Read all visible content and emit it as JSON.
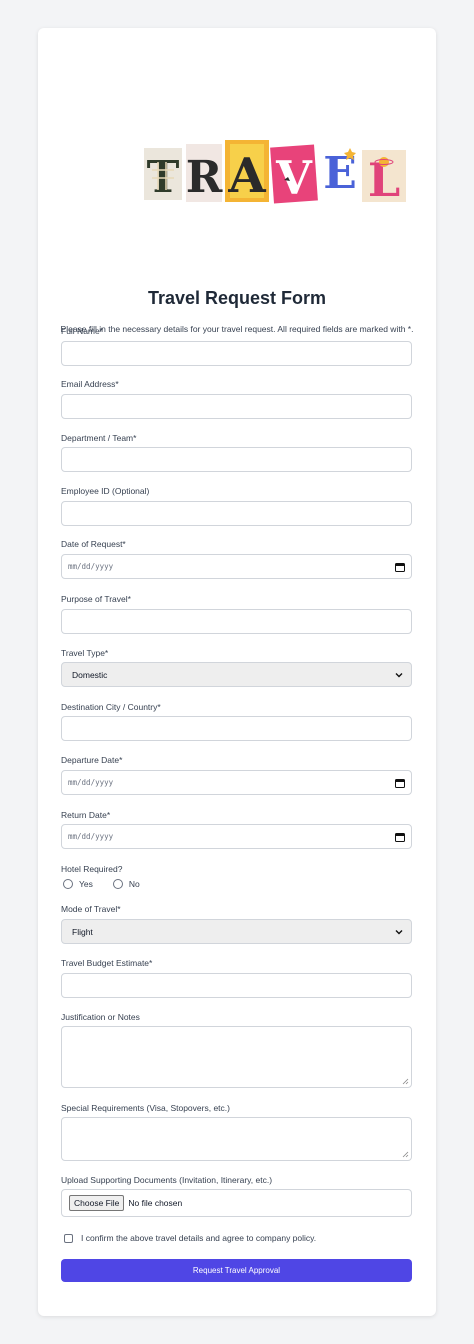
{
  "logo": {
    "letters": [
      "T",
      "R",
      "A",
      "V",
      "E",
      "L"
    ]
  },
  "form": {
    "title": "Travel Request Form",
    "subtitle": "Please fill in the necessary details for your travel request. All required fields are marked with *.",
    "full_name_label": "Full Name*",
    "email_label": "Email Address*",
    "department_label": "Department / Team*",
    "employee_id_label": "Employee ID (Optional)",
    "date_of_request_label": "Date of Request*",
    "date_placeholder": "mm/dd/yyyy",
    "purpose_label": "Purpose of Travel*",
    "travel_type_label": "Travel Type*",
    "travel_type_value": "Domestic",
    "destination_label": "Destination City / Country*",
    "departure_date_label": "Departure Date*",
    "return_date_label": "Return Date*",
    "hotel_label": "Hotel Required?",
    "hotel_yes": "Yes",
    "hotel_no": "No",
    "mode_label": "Mode of Travel*",
    "mode_value": "Flight",
    "budget_label": "Travel Budget Estimate*",
    "justification_label": "Justification or Notes",
    "special_label": "Special Requirements (Visa, Stopovers, etc.)",
    "upload_label": "Upload Supporting Documents (Invitation, Itinerary, etc.)",
    "choose_file": "Choose File",
    "no_file": "No file chosen",
    "confirm_text": "I confirm the above travel details and agree to company policy.",
    "submit_label": "Request Travel Approval"
  },
  "colors": {
    "accent": "#4f46e5",
    "page_bg": "#f3f4f6",
    "card_bg": "#ffffff"
  }
}
